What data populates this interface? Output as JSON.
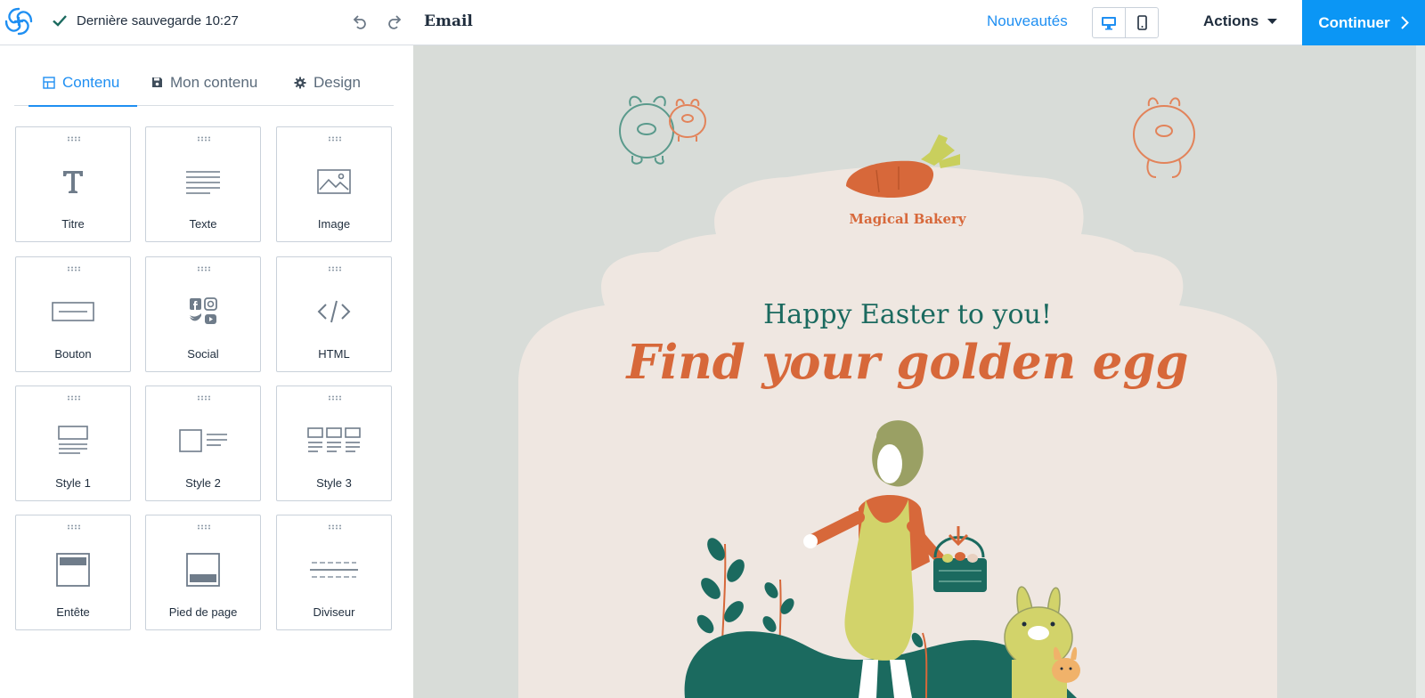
{
  "topbar": {
    "save_status": "Dernière sauvegarde 10:27",
    "doc_title": "Email",
    "news_link": "Nouveautés",
    "actions_label": "Actions",
    "continue_label": "Continuer"
  },
  "sidebar": {
    "tabs": [
      {
        "label": "Contenu",
        "icon": "grid-icon",
        "active": true
      },
      {
        "label": "Mon contenu",
        "icon": "save-icon",
        "active": false
      },
      {
        "label": "Design",
        "icon": "gear-icon",
        "active": false
      }
    ],
    "blocks": [
      {
        "label": "Titre",
        "icon": "title-icon"
      },
      {
        "label": "Texte",
        "icon": "text-icon"
      },
      {
        "label": "Image",
        "icon": "image-icon"
      },
      {
        "label": "Bouton",
        "icon": "button-icon"
      },
      {
        "label": "Social",
        "icon": "social-icon"
      },
      {
        "label": "HTML",
        "icon": "html-code-icon"
      },
      {
        "label": "Style 1",
        "icon": "style1-icon"
      },
      {
        "label": "Style 2",
        "icon": "style2-icon"
      },
      {
        "label": "Style 3",
        "icon": "style3-icon"
      },
      {
        "label": "Entête",
        "icon": "header-icon"
      },
      {
        "label": "Pied de page",
        "icon": "footer-icon"
      },
      {
        "label": "Diviseur",
        "icon": "divider-icon"
      }
    ]
  },
  "email": {
    "brand": "Magical Bakery",
    "greeting": "Happy Easter to you!",
    "headline": "Find your golden egg"
  },
  "colors": {
    "accent": "#1f8ff2",
    "continue_bg": "#0b96f5",
    "canvas_bg": "#d8dcd8",
    "email_bg": "#efe7e1",
    "orange": "#d7683a",
    "teal": "#1b6a5f"
  }
}
